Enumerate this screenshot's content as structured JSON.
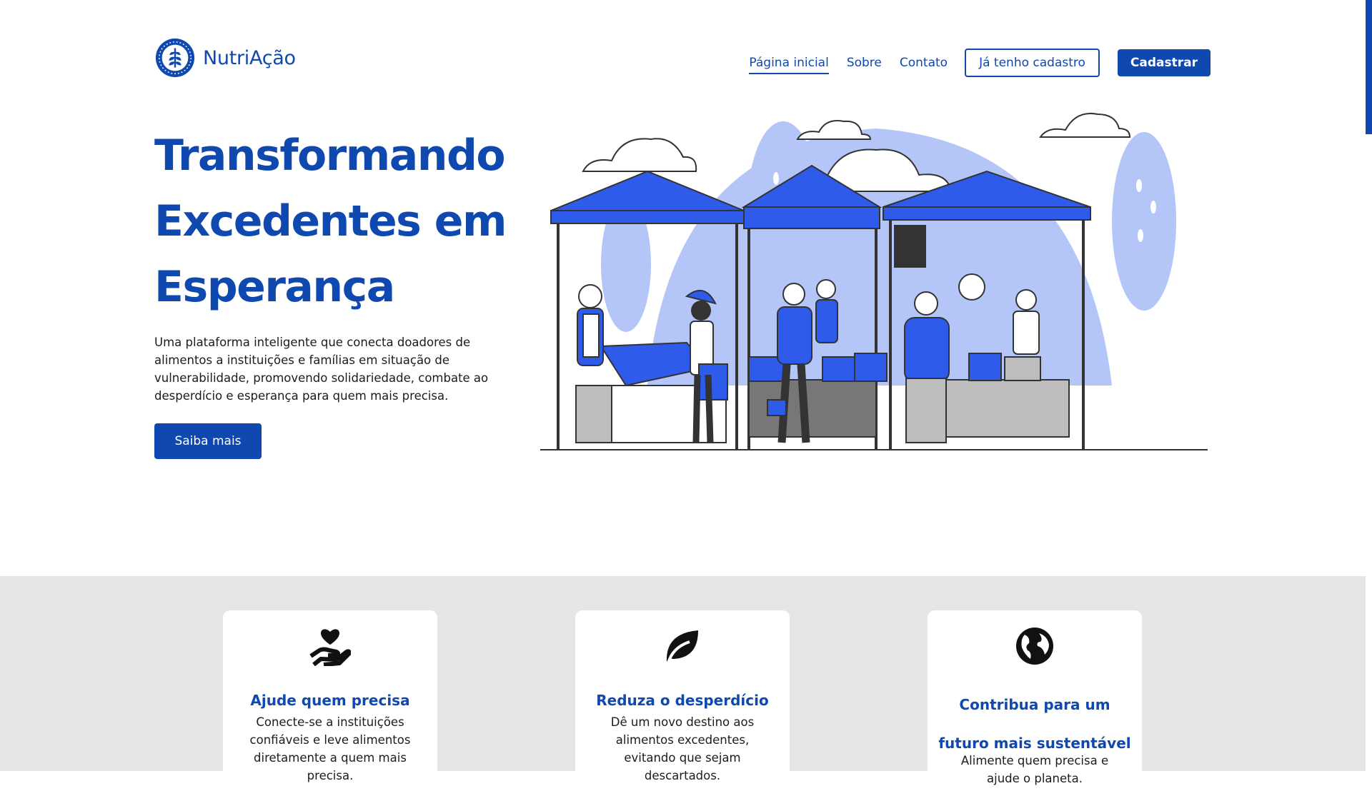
{
  "brand": {
    "name": "NutriAção",
    "logo_icon": "wheat-seal-icon"
  },
  "nav": {
    "home": "Página inicial",
    "about": "Sobre",
    "contact": "Contato",
    "login": "Já tenho cadastro",
    "register": "Cadastrar"
  },
  "hero": {
    "title": "Transformando Excedentes em Esperança",
    "description": "Uma plataforma inteligente que conecta doadores de alimentos a instituições e famílias em situação de vulnerabilidade, promovendo solidariedade, combate ao desperdício e esperança para quem mais precisa.",
    "cta": "Saiba mais",
    "illustration": "market-stalls-illustration"
  },
  "features": [
    {
      "icon": "hand-heart-icon",
      "title": "Ajude quem precisa",
      "text": "Conecte-se a instituições confiáveis e leve alimentos diretamente a quem mais precisa."
    },
    {
      "icon": "leaf-icon",
      "title": "Reduza o desperdício",
      "text": "Dê um novo destino aos alimentos excedentes, evitando que sejam descartados."
    },
    {
      "icon": "globe-icon",
      "title": "Contribua para um futuro mais sustentável",
      "text": "Alimente quem precisa e ajude o planeta."
    }
  ],
  "colors": {
    "primary": "#0f49b0",
    "accent": "#2e5bea",
    "light_accent": "#b3c6f7",
    "section_bg": "#e6e6e6"
  }
}
